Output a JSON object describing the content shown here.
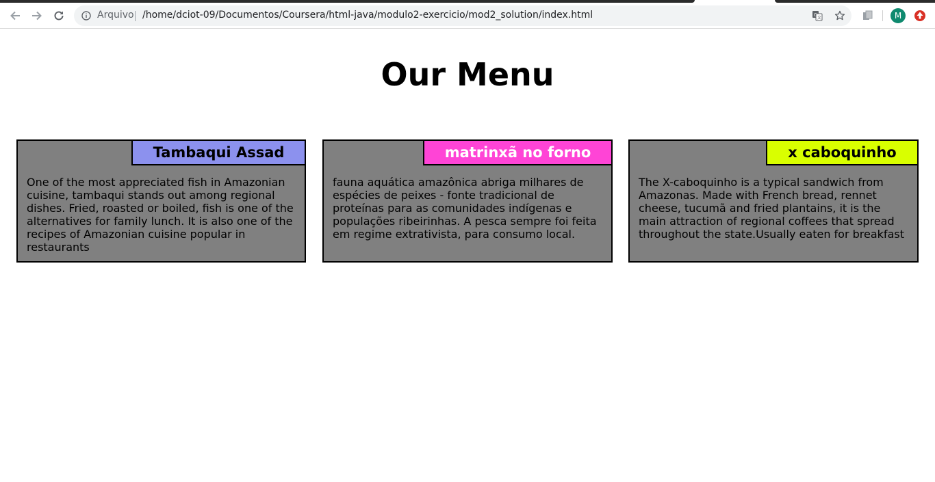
{
  "browser": {
    "origin_label": "Arquivo",
    "url": "/home/dciot-09/Documentos/Coursera/html-java/modulo2-exercicio/mod2_solution/index.html",
    "profile_initial": "M",
    "icons": [
      "back-arrow-icon",
      "forward-arrow-icon",
      "reload-icon",
      "info-icon",
      "translate-icon",
      "star-icon",
      "extension-icon",
      "profile-avatar",
      "update-icon"
    ],
    "colors": {
      "avatar": "#0f8a6f",
      "update": "#d93025"
    }
  },
  "page": {
    "title": "Our Menu",
    "cards": [
      {
        "name": "Tambaqui Assad",
        "name_color": "#8c91ee",
        "description": "One of the most appreciated fish in Amazonian cuisine, tambaqui stands out among regional dishes. Fried, roasted or boiled, fish is one of the alternatives for family lunch. It is also one of the recipes of Amazonian cuisine popular in restaurants"
      },
      {
        "name": "matrinxã no forno",
        "name_color": "#ff44d6",
        "description": "fauna aquática amazônica abriga milhares de espécies de peixes - fonte tradicional de proteínas para as comunidades indígenas e populações ribeirinhas. A pesca sempre foi feita em regime extrativista, para consumo local."
      },
      {
        "name": "x caboquinho",
        "name_color": "#d9ff00",
        "description": "The X-caboquinho is a typical sandwich from Amazonas. Made with French bread, rennet cheese, tucumã and fried plantains, it is the main attraction of regional coffees that spread throughout the state.Usually eaten for breakfast"
      }
    ],
    "colors": {
      "card_background": "#808080",
      "border": "#000000"
    }
  }
}
